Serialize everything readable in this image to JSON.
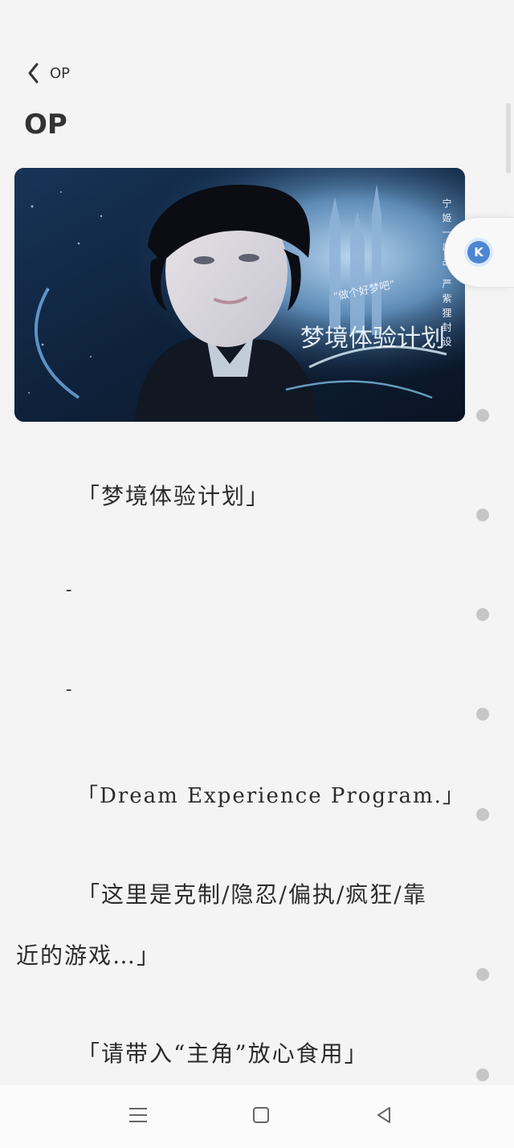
{
  "header": {
    "back_label": "OP",
    "title": "OP"
  },
  "cover": {
    "icon": "portrait-cover-image",
    "tagline": "“做个好梦吧”",
    "vertical_credit": "宁姬一出品 严紫狸封设",
    "calligraphy": "梦境体验计划"
  },
  "floating_button": {
    "label": "K"
  },
  "article": {
    "title_line": "「梦境体验计划」",
    "separator_1": "-",
    "separator_2": "-",
    "english_line": "「Dream Experience Program.」",
    "desc_line_1": "「这里是克制/隐忍/偏执/疯狂/靠",
    "desc_line_2": "近的游戏…」",
    "note_line": "「请带入“主角”放心食用」"
  },
  "colors": {
    "background": "#f4f4f4",
    "accent_blue": "#4c86d3",
    "dot_gray": "#c6c6c6"
  },
  "navigation": {
    "menu_icon": "menu-icon",
    "home_icon": "home-square-icon",
    "back_icon": "back-triangle-icon"
  }
}
